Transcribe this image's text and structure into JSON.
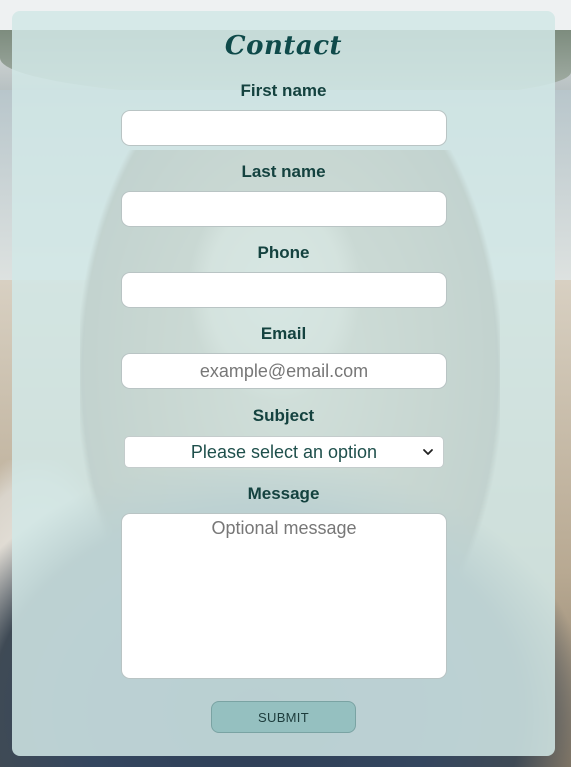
{
  "form": {
    "title": "Contact",
    "first_name": {
      "label": "First name",
      "value": "",
      "placeholder": ""
    },
    "last_name": {
      "label": "Last name",
      "value": "",
      "placeholder": ""
    },
    "phone": {
      "label": "Phone",
      "value": "",
      "placeholder": ""
    },
    "email": {
      "label": "Email",
      "value": "",
      "placeholder": "example@email.com"
    },
    "subject": {
      "label": "Subject",
      "selected": "Please select an option"
    },
    "message": {
      "label": "Message",
      "placeholder": "Optional message"
    },
    "submit_label": "SUBMIT"
  },
  "colors": {
    "card_bg": "#d2e8e6",
    "label": "#14423f",
    "title": "#0f4a4a",
    "submit_bg": "#95c0c0"
  },
  "icons": {
    "select_arrow": "chevron-down-icon"
  }
}
